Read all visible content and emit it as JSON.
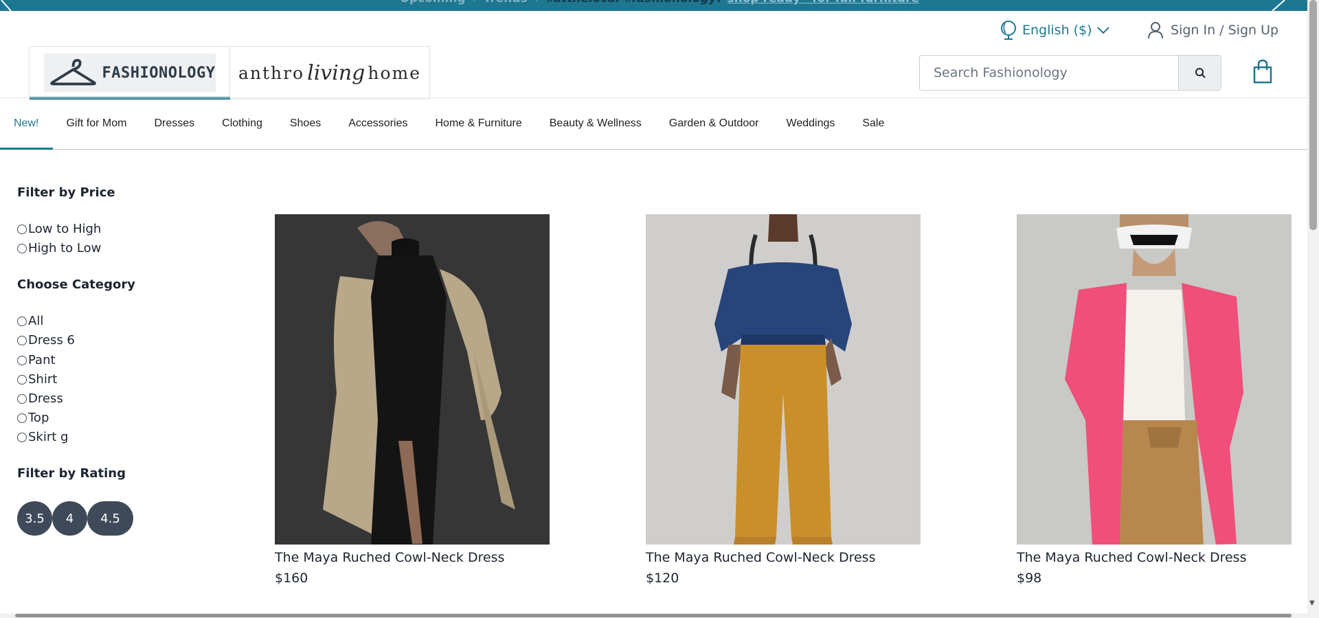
{
  "banner": {
    "text": "Upcoming ✦ Trends ✦",
    "em_text": "#atthelocal #fashionology?",
    "link_text": "shop ready—for fall furniture"
  },
  "header": {
    "language": "English ($)",
    "sign_in": "Sign In / Sign Up",
    "logo_main": "FASHIONOLOGY",
    "logo_anthro_left": "anthro",
    "logo_anthro_script": "living",
    "logo_anthro_right": "home",
    "search_placeholder": "Search Fashionology"
  },
  "nav": {
    "items": [
      "New!",
      "Gift for Mom",
      "Dresses",
      "Clothing",
      "Shoes",
      "Accessories",
      "Home & Furniture",
      "Beauty & Wellness",
      "Garden & Outdoor",
      "Weddings",
      "Sale"
    ]
  },
  "filters": {
    "price_title": "Filter by Price",
    "price_options": [
      "Low to High",
      "High to Low"
    ],
    "category_title": "Choose Category",
    "category_options": [
      "All",
      "Dress 6",
      "Pant",
      "Shirt",
      "Dress",
      "Top",
      "Skirt g"
    ],
    "rating_title": "Filter by Rating",
    "ratings": [
      "3.5",
      "4",
      "4.5"
    ]
  },
  "products": [
    {
      "name": "The Maya Ruched Cowl-Neck Dress",
      "price": "$160"
    },
    {
      "name": "The Maya Ruched Cowl-Neck Dress",
      "price": "$120"
    },
    {
      "name": "The Maya Ruched Cowl-Neck Dress",
      "price": "$98"
    }
  ],
  "colors": {
    "accent": "#1e7791",
    "rating_pill": "#3e4a59",
    "text": "#1c2430"
  }
}
